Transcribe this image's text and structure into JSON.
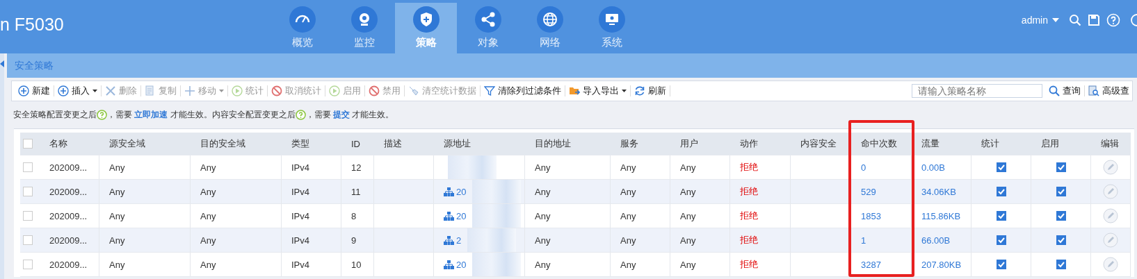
{
  "header": {
    "title": "n F5030",
    "nav": [
      {
        "label": "概览",
        "selected": false
      },
      {
        "label": "监控",
        "selected": false
      },
      {
        "label": "策略",
        "selected": true
      },
      {
        "label": "对象",
        "selected": false
      },
      {
        "label": "网络",
        "selected": false
      },
      {
        "label": "系统",
        "selected": false
      }
    ],
    "user": "admin"
  },
  "breadcrumb": "安全策略",
  "toolbar": {
    "items": [
      {
        "label": "新建",
        "disabled": false,
        "dropdown": false
      },
      {
        "label": "插入",
        "disabled": false,
        "dropdown": true
      },
      {
        "label": "删除",
        "disabled": true,
        "dropdown": false
      },
      {
        "label": "复制",
        "disabled": true,
        "dropdown": false
      },
      {
        "label": "移动",
        "disabled": true,
        "dropdown": true
      },
      {
        "label": "统计",
        "disabled": true,
        "dropdown": false
      },
      {
        "label": "取消统计",
        "disabled": true,
        "dropdown": false
      },
      {
        "label": "启用",
        "disabled": true,
        "dropdown": false
      },
      {
        "label": "禁用",
        "disabled": true,
        "dropdown": false
      },
      {
        "label": "清空统计数据",
        "disabled": true,
        "dropdown": false
      },
      {
        "label": "清除列过滤条件",
        "disabled": false,
        "dropdown": false
      },
      {
        "label": "导入导出",
        "disabled": false,
        "dropdown": true
      },
      {
        "label": "刷新",
        "disabled": false,
        "dropdown": false
      }
    ],
    "search": {
      "placeholder": "请输入策略名称"
    },
    "query": "查询",
    "advanced": "高级查"
  },
  "notice": [
    {
      "kind": "text",
      "text": "安全策略配置变更之后"
    },
    {
      "kind": "help"
    },
    {
      "kind": "text",
      "text": "，需要 "
    },
    {
      "kind": "link",
      "text": "立即加速"
    },
    {
      "kind": "text",
      "text": " 才能生效。内容安全配置变更之后"
    },
    {
      "kind": "help"
    },
    {
      "kind": "text",
      "text": "，需要 "
    },
    {
      "kind": "link",
      "text": "提交"
    },
    {
      "kind": "text",
      "text": " 才能生效。"
    }
  ],
  "table": {
    "select_all_checked": false,
    "columns": [
      {
        "label": "名称",
        "highlighted": false
      },
      {
        "label": "源安全域",
        "highlighted": false
      },
      {
        "label": "目的安全域",
        "highlighted": false
      },
      {
        "label": "类型",
        "highlighted": false
      },
      {
        "label": "ID",
        "highlighted": false
      },
      {
        "label": "描述",
        "highlighted": false
      },
      {
        "label": "源地址",
        "highlighted": false
      },
      {
        "label": "目的地址",
        "highlighted": false
      },
      {
        "label": "服务",
        "highlighted": false
      },
      {
        "label": "用户",
        "highlighted": false
      },
      {
        "label": "动作",
        "highlighted": false
      },
      {
        "label": "内容安全",
        "highlighted": false
      },
      {
        "label": "命中次数",
        "highlighted": true
      },
      {
        "label": "流量",
        "highlighted": false
      },
      {
        "label": "统计",
        "highlighted": false
      },
      {
        "label": "启用",
        "highlighted": false
      },
      {
        "label": "编辑",
        "highlighted": false
      }
    ],
    "rows": [
      {
        "checked": false,
        "name": "202009...",
        "src_zone": "Any",
        "dst_zone": "Any",
        "type": "IPv4",
        "id": "12",
        "dst_addr": "Any",
        "service": "Any",
        "user": "Any",
        "action": "拒绝",
        "hits": "0",
        "traffic": "0.00B",
        "stats": true,
        "enabled": true
      },
      {
        "checked": false,
        "name": "202009...",
        "src_zone": "Any",
        "dst_zone": "Any",
        "type": "IPv4",
        "id": "11",
        "src_addr": "20",
        "dst_addr": "Any",
        "service": "Any",
        "user": "Any",
        "action": "拒绝",
        "hits": "529",
        "traffic": "34.06KB",
        "stats": true,
        "enabled": true
      },
      {
        "checked": false,
        "name": "202009...",
        "src_zone": "Any",
        "dst_zone": "Any",
        "type": "IPv4",
        "id": "8",
        "src_addr": "20",
        "dst_addr": "Any",
        "service": "Any",
        "user": "Any",
        "action": "拒绝",
        "hits": "1853",
        "traffic": "115.86KB",
        "stats": true,
        "enabled": true
      },
      {
        "checked": false,
        "name": "202009...",
        "src_zone": "Any",
        "dst_zone": "Any",
        "type": "IPv4",
        "id": "9",
        "src_addr": "2",
        "dst_addr": "Any",
        "service": "Any",
        "user": "Any",
        "action": "拒绝",
        "hits": "1",
        "traffic": "66.00B",
        "stats": true,
        "enabled": true
      },
      {
        "checked": false,
        "name": "202009...",
        "src_zone": "Any",
        "dst_zone": "Any",
        "type": "IPv4",
        "id": "10",
        "src_addr": "20",
        "dst_addr": "Any",
        "service": "Any",
        "user": "Any",
        "action": "拒绝",
        "hits": "3287",
        "traffic": "207.80KB",
        "stats": true,
        "enabled": true
      }
    ]
  }
}
